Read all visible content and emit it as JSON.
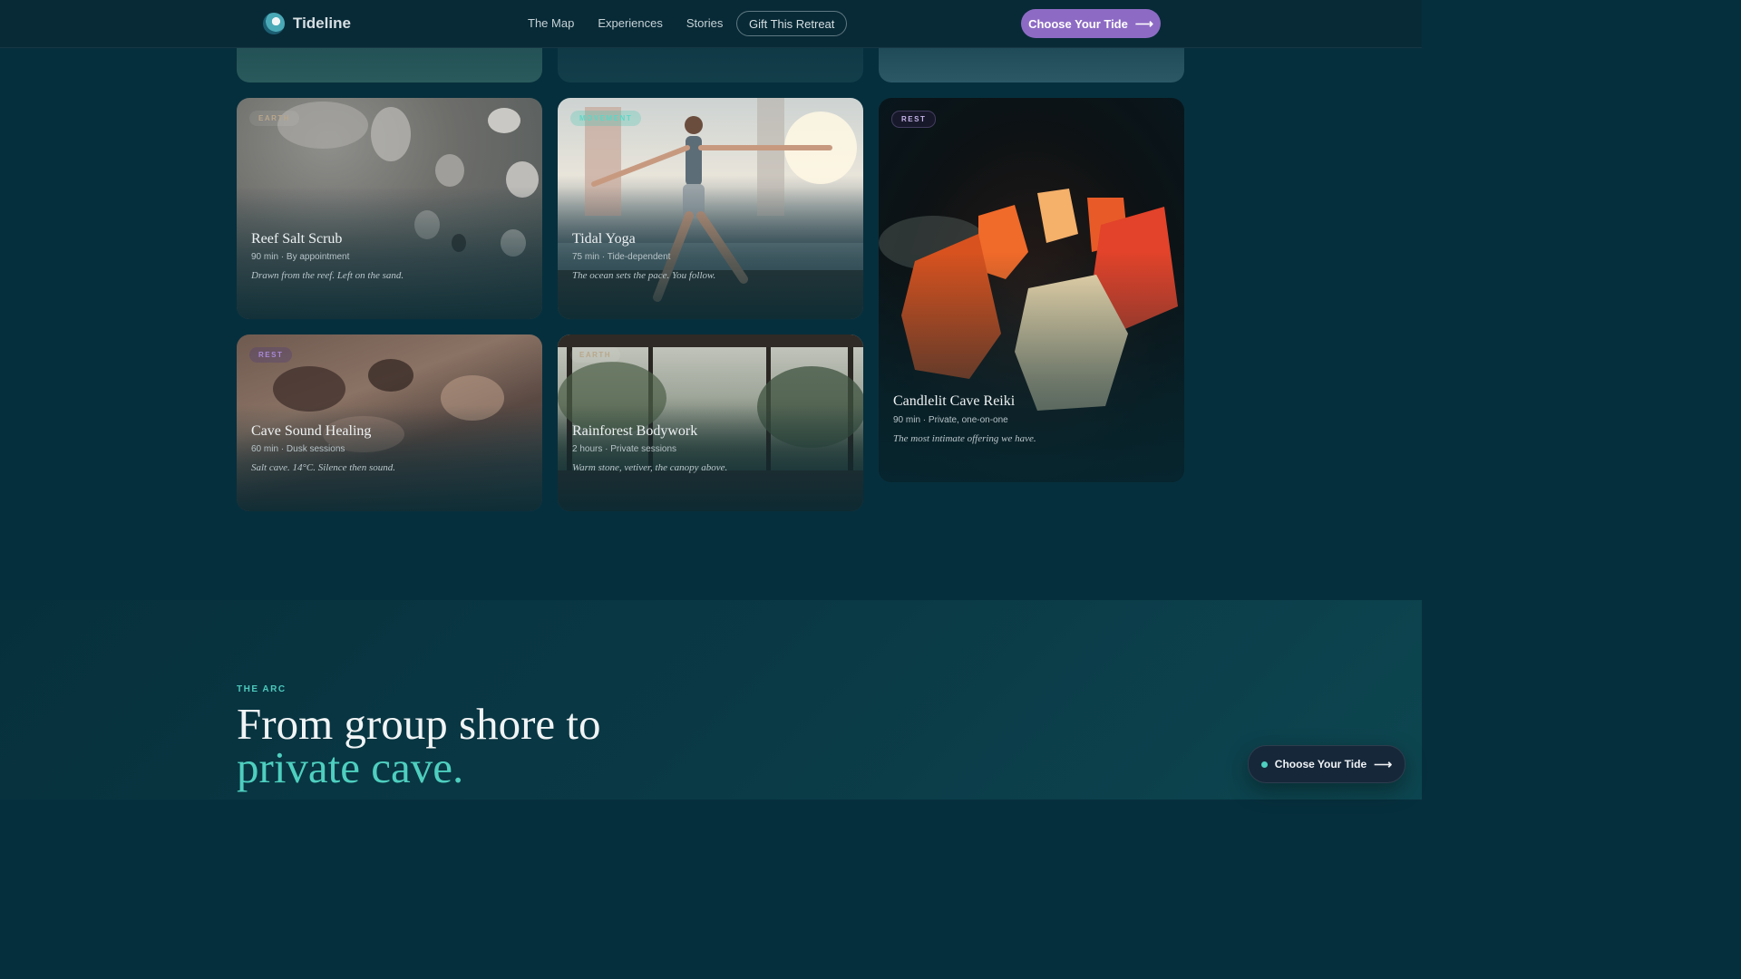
{
  "brand": {
    "name": "Tideline",
    "logo_icon": "wave-globe-icon"
  },
  "nav": {
    "items": [
      "The Map",
      "Experiences",
      "Stories"
    ],
    "gift": "Gift This Retreat"
  },
  "header_cta": {
    "label": "Choose Your Tide",
    "icon": "arrow-right-icon"
  },
  "cards": [
    {
      "badge": "EARTH",
      "title": "Reef Salt Scrub",
      "duration": "90 min",
      "detail": "By appointment",
      "tagline": "Drawn from the reef. Left on the sand.",
      "image": "shells-on-sand"
    },
    {
      "badge": "MOVEMENT",
      "title": "Tidal Yoga",
      "duration": "75 min",
      "detail": "Tide-dependent",
      "tagline": "The ocean sets the pace. You follow.",
      "image": "yoga-pier-sunset"
    },
    {
      "badge": "REST",
      "title": "Candlelit Cave Reiki",
      "duration": "90 min",
      "detail": "Private, one-on-one",
      "tagline": "The most intimate offering we have.",
      "image": "salt-lamps-cave"
    },
    {
      "badge": "REST",
      "title": "Cave Sound Healing",
      "duration": "60 min",
      "detail": "Dusk sessions",
      "tagline": "Salt cave. 14°C. Silence then sound.",
      "image": "sandstone-cave"
    },
    {
      "badge": "EARTH",
      "title": "Rainforest Bodywork",
      "duration": "2 hours",
      "detail": "Private sessions",
      "tagline": "Warm stone, vetiver, the canopy above.",
      "image": "rainforest-pavilion"
    }
  ],
  "section": {
    "eyebrow": "THE ARC",
    "headline_line1": "From group shore to",
    "headline_line2": "private cave."
  },
  "float_cta": {
    "label": "Choose Your Tide",
    "icon": "arrow-right-icon"
  }
}
